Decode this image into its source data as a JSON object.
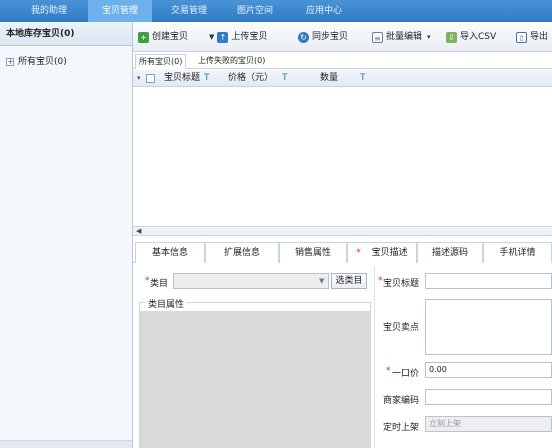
{
  "topnav": {
    "tabs": [
      "我的助理",
      "宝贝管理",
      "交易管理",
      "图片空间",
      "应用中心"
    ],
    "active": "宝贝管理"
  },
  "sidebar": {
    "title": "本地库存宝贝(0)",
    "tree_item": "所有宝贝(0)",
    "expand_glyph": "+"
  },
  "toolbar": {
    "create": "创建宝贝",
    "upload": "上传宝贝",
    "sync": "同步宝贝",
    "batch_edit": "批量编辑",
    "import_csv": "导入CSV",
    "export": "导出"
  },
  "list_tabs": [
    "所有宝贝(0)",
    "上传失败的宝贝(0)"
  ],
  "columns": {
    "title": "宝贝标题",
    "price": "价格（元）",
    "quantity": "数量",
    "filter_glyph": "T"
  },
  "detail_tabs": [
    "基本信息",
    "扩展信息",
    "销售属性",
    "宝贝描述",
    "描述源码",
    "手机详情"
  ],
  "form": {
    "category_label": "类目",
    "select_category_button": "选类目",
    "category_attributes_label": "类目属性",
    "title_label": "宝贝标题",
    "selling_points_label": "宝贝卖点",
    "price_label": "一口价",
    "price_value": "0.00",
    "merchant_code_label": "商家编码",
    "scheduled_listing_label": "定时上架",
    "scheduled_listing_value": "立刻上架",
    "required_mark": "*"
  },
  "colors": {
    "nav_bg": "#2f7bc4",
    "nav_active": "#6cb0ec",
    "required": "#d22222",
    "panel_bg": "#f4f7fb"
  }
}
